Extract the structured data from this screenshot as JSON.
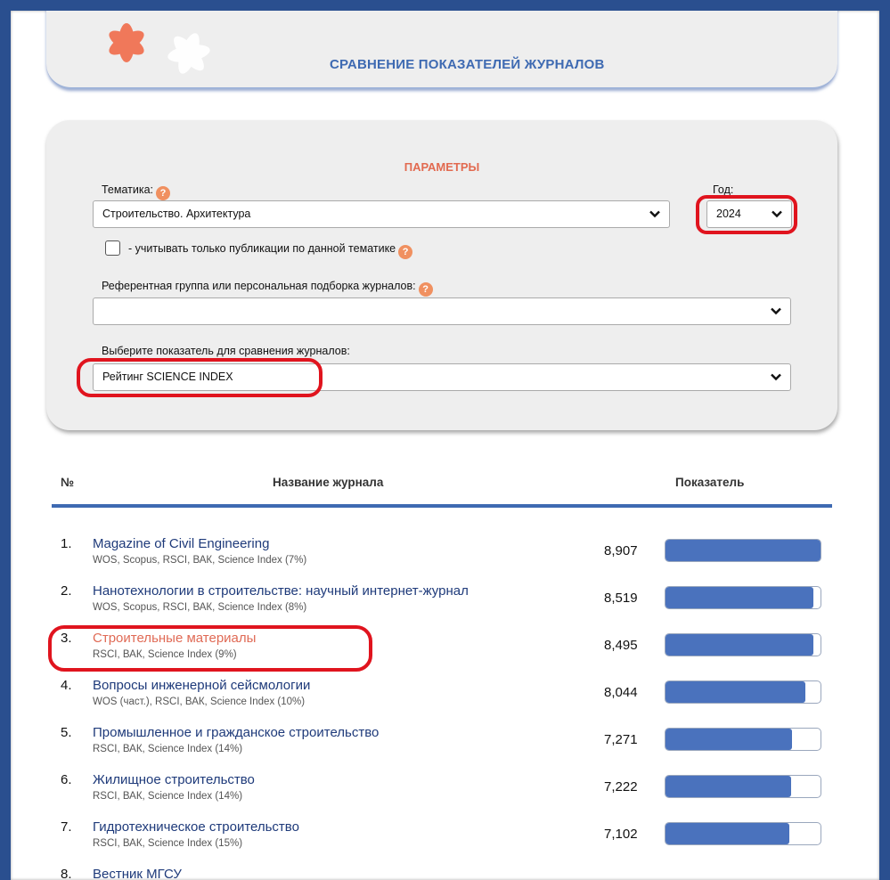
{
  "header": {
    "title": "СРАВНЕНИЕ ПОКАЗАТЕЛЕЙ ЖУРНАЛОВ"
  },
  "params": {
    "title": "ПАРАМЕТРЫ",
    "topic_label": "Тематика:",
    "topic_value": "Строительство. Архитектура",
    "year_label": "Год:",
    "year_value": "2024",
    "only_topic_label": "- учитывать только публикации по данной тематике",
    "only_topic_checked": false,
    "ref_group_label": "Референтная группа или персональная подборка журналов:",
    "ref_group_value": "",
    "indicator_label": "Выберите показатель для сравнения журналов:",
    "indicator_value": "Рейтинг SCIENCE INDEX",
    "help_icon": "question-icon"
  },
  "table": {
    "col_num": "№",
    "col_name": "Название журнала",
    "col_value": "Показатель",
    "rows": [
      {
        "num": "1.",
        "name": "Magazine of Civil Engineering",
        "sub": "WOS, Scopus, RSCI, ВАК, Science Index (7%)",
        "value": "8,907",
        "fill": 1.0,
        "highlight": false
      },
      {
        "num": "2.",
        "name": "Нанотехнологии в строительстве: научный интернет-журнал",
        "sub": "WOS, Scopus, RSCI, ВАК, Science Index (8%)",
        "value": "8,519",
        "fill": 0.956,
        "highlight": false
      },
      {
        "num": "3.",
        "name": "Строительные материалы",
        "sub": "RSCI, ВАК, Science Index (9%)",
        "value": "8,495",
        "fill": 0.954,
        "highlight": true
      },
      {
        "num": "4.",
        "name": "Вопросы инженерной сейсмологии",
        "sub": "WOS (част.), RSCI, ВАК, Science Index (10%)",
        "value": "8,044",
        "fill": 0.903,
        "highlight": false
      },
      {
        "num": "5.",
        "name": "Промышленное и гражданское строительство",
        "sub": "RSCI, ВАК, Science Index (14%)",
        "value": "7,271",
        "fill": 0.816,
        "highlight": false
      },
      {
        "num": "6.",
        "name": "Жилищное строительство",
        "sub": "RSCI, ВАК, Science Index (14%)",
        "value": "7,222",
        "fill": 0.811,
        "highlight": false
      },
      {
        "num": "7.",
        "name": "Гидротехническое строительство",
        "sub": "RSCI, ВАК, Science Index (15%)",
        "value": "7,102",
        "fill": 0.797,
        "highlight": false
      },
      {
        "num": "8.",
        "name": "Вестник МГСУ",
        "sub": "",
        "value": "",
        "fill": 0.0,
        "highlight": false
      }
    ]
  },
  "colors": {
    "accent": "#3e6ab2",
    "bar_fill": "#4a72bd",
    "highlight_text": "#e06a55",
    "annotation_ring": "#e0141e"
  }
}
